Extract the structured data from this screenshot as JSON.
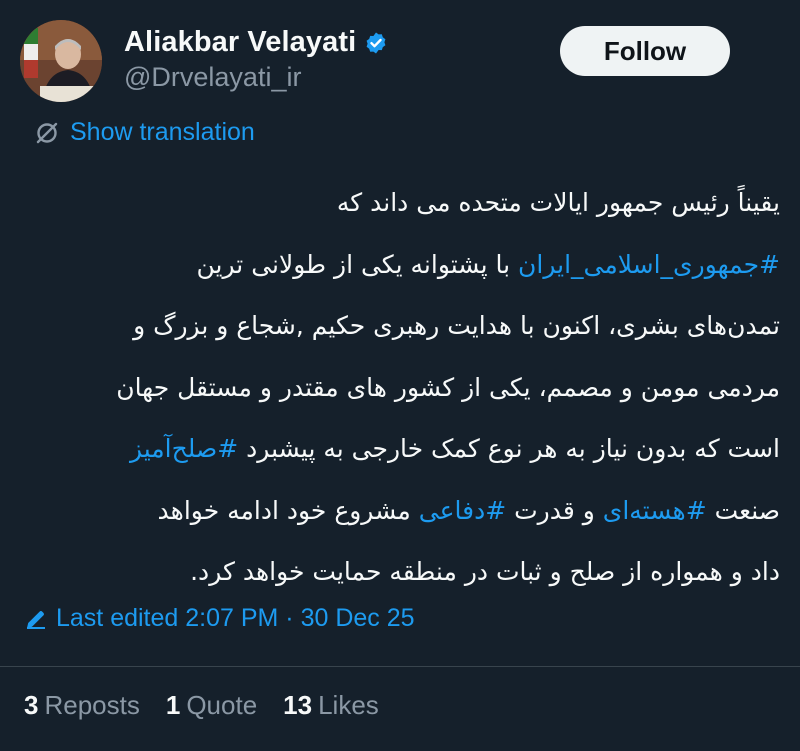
{
  "author": {
    "display_name": "Aliakbar Velayati",
    "handle": "@Drvelayati_ir",
    "verified": true
  },
  "follow_label": "Follow",
  "translation_label": "Show translation",
  "tweet": {
    "lines": [
      [
        {
          "t": "یقیناً رئیس جمهور ایالات متحده می داند که",
          "h": false
        }
      ],
      [
        {
          "t": "#جمهوری_اسلامی_ایران",
          "h": true
        },
        {
          "t": " با پشتوانه یکی از طولانی ترین",
          "h": false
        }
      ],
      [
        {
          "t": "تمدن‌های بشری، اکنون با هدایت رهبری حکیم ,شجاع و بزرگ و",
          "h": false
        }
      ],
      [
        {
          "t": "مردمی مومن و مصمم، یکی از کشور های مقتدر و مستقل جهان",
          "h": false
        }
      ],
      [
        {
          "t": "است که بدون نیاز به هر نوع کمک خارجی به پیشبرد ",
          "h": false
        },
        {
          "t": "#صلح‌آمیز",
          "h": true
        }
      ],
      [
        {
          "t": "صنعت ",
          "h": false
        },
        {
          "t": "#هسته‌ای",
          "h": true
        },
        {
          "t": " و قدرت ",
          "h": false
        },
        {
          "t": "#دفاعی",
          "h": true
        },
        {
          "t": " مشروع خود ادامه خواهد",
          "h": false
        }
      ],
      [
        {
          "t": "داد و همواره از صلح و ثبات در منطقه حمایت خواهد کرد.",
          "h": false
        }
      ]
    ]
  },
  "edited": {
    "label": "Last edited 2:07 PM · 30 Dec 25"
  },
  "stats": [
    {
      "count": "3",
      "label": "Reposts"
    },
    {
      "count": "1",
      "label": "Quote"
    },
    {
      "count": "13",
      "label": "Likes"
    }
  ],
  "colors": {
    "background": "#15202b",
    "accent": "#1d9bf0",
    "secondary_text": "#8b98a5",
    "primary_text": "#f7f9f9"
  },
  "icons": {
    "verified": "verified-badge-icon",
    "translate": "translate-icon",
    "edit": "pencil-icon"
  }
}
